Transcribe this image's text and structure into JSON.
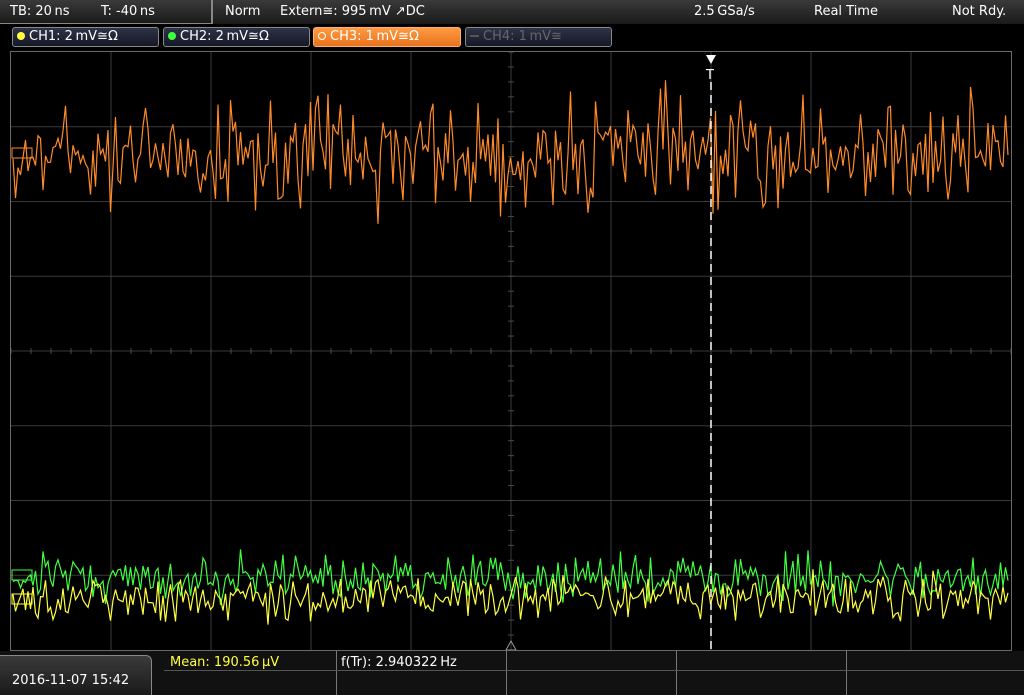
{
  "status_bar": {
    "timebase": "TB: 20 ns",
    "trigger_time": "T: -40 ns",
    "trigger_mode": "Norm",
    "trigger_source": "Extern≅: 995 mV ↗DC",
    "sample_rate": "2.5 GSa/s",
    "acq_mode": "Real Time",
    "state": "Not Rdy."
  },
  "channels": [
    {
      "label": "CH1: 2 mV≅Ω",
      "color": "#ffff40",
      "active": true
    },
    {
      "label": "CH2: 2 mV≅Ω",
      "color": "#40ff40",
      "active": true
    },
    {
      "label": "CH3: 1 mV≅Ω",
      "color": "#ff8a2a",
      "active": true,
      "selected": true
    },
    {
      "label": "CH4: 1 mV≅",
      "color": "#666666",
      "active": false
    }
  ],
  "trigger_marker": "T",
  "measurements": {
    "datetime": "2016-11-07 15:42",
    "mean": "Mean: 190.56 µV",
    "freq": "f(Tr): 2.940322 Hz"
  }
}
